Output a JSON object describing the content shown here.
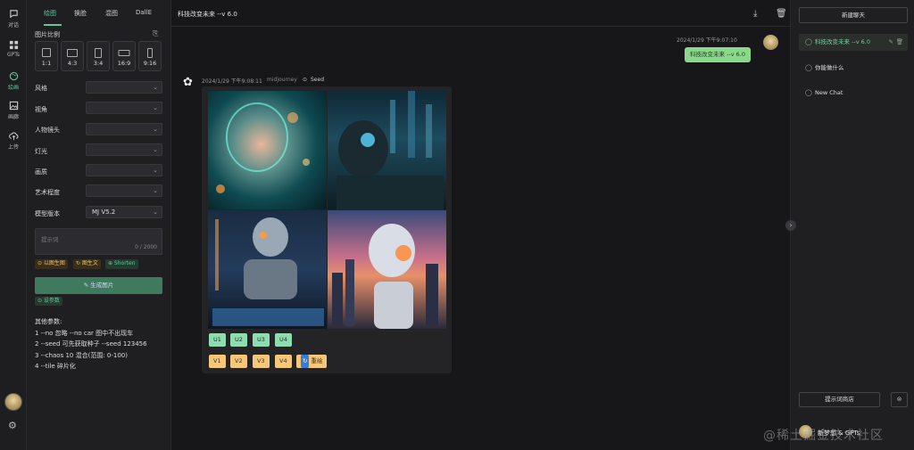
{
  "rail": {
    "items": [
      {
        "label": "对话",
        "icon": "chat-icon"
      },
      {
        "label": "GPTs",
        "icon": "grid-icon"
      },
      {
        "label": "绘画",
        "icon": "palette-icon"
      },
      {
        "label": "画廊",
        "icon": "image-icon"
      },
      {
        "label": "上传",
        "icon": "cloud-upload-icon"
      }
    ]
  },
  "left": {
    "tabs": [
      "绘图",
      "换脸",
      "混图",
      "DallE"
    ],
    "ratio_label": "图片比例",
    "ratios": [
      "1:1",
      "4:3",
      "3:4",
      "16:9",
      "9:16"
    ],
    "selects": [
      {
        "label": "风格",
        "value": ""
      },
      {
        "label": "视角",
        "value": ""
      },
      {
        "label": "人物镜头",
        "value": ""
      },
      {
        "label": "灯光",
        "value": ""
      },
      {
        "label": "画质",
        "value": ""
      },
      {
        "label": "艺术程度",
        "value": ""
      },
      {
        "label": "模型版本",
        "value": "MJ V5.2"
      }
    ],
    "prompt_placeholder": "提示词",
    "prompt_count": "0 / 2000",
    "chips": [
      "⊙ 以图生图",
      "↻ 图生文",
      "⊕ Shorten"
    ],
    "generate_label": "✎ 生成图片",
    "params_chip": "⊙ 设参数",
    "other_title": "其他参数:",
    "other_lines": [
      "1 --no 忽略 --no car 图中不出现车",
      "2 --seed 可先获取种子 --seed 123456",
      "3 --chaos 10 混合(范围: 0-100)",
      "4 --tile 碎片化"
    ]
  },
  "chat": {
    "title": "科技改变未来 --v 6.0",
    "user_time": "2024/1/29 下午9:07:10",
    "user_msg": "科技改变未来 --v 6.0",
    "bot_time": "2024/1/29 下午9:08:11",
    "bot_source": "midjourney",
    "seed_label": "Seed",
    "u_buttons": [
      "U1",
      "U2",
      "U3",
      "U4"
    ],
    "v_buttons": [
      "V1",
      "V2",
      "V3",
      "V4"
    ],
    "redraw_label": "重绘"
  },
  "right": {
    "new_chat": "新建聊天",
    "history": [
      {
        "label": "科技改变未来 --v 6.0",
        "active": true
      },
      {
        "label": "你能做什么",
        "active": false
      },
      {
        "label": "New Chat",
        "active": false
      }
    ],
    "market_label": "提示词商店",
    "bot_name": "新梦想 & GPTs"
  },
  "watermark": "@稀土掘金技术社区",
  "colors": {
    "accent": "#5fc99a",
    "user_bubble": "#8ad98a",
    "u_btn": "#8fdcb0",
    "v_btn": "#f4c77a"
  }
}
